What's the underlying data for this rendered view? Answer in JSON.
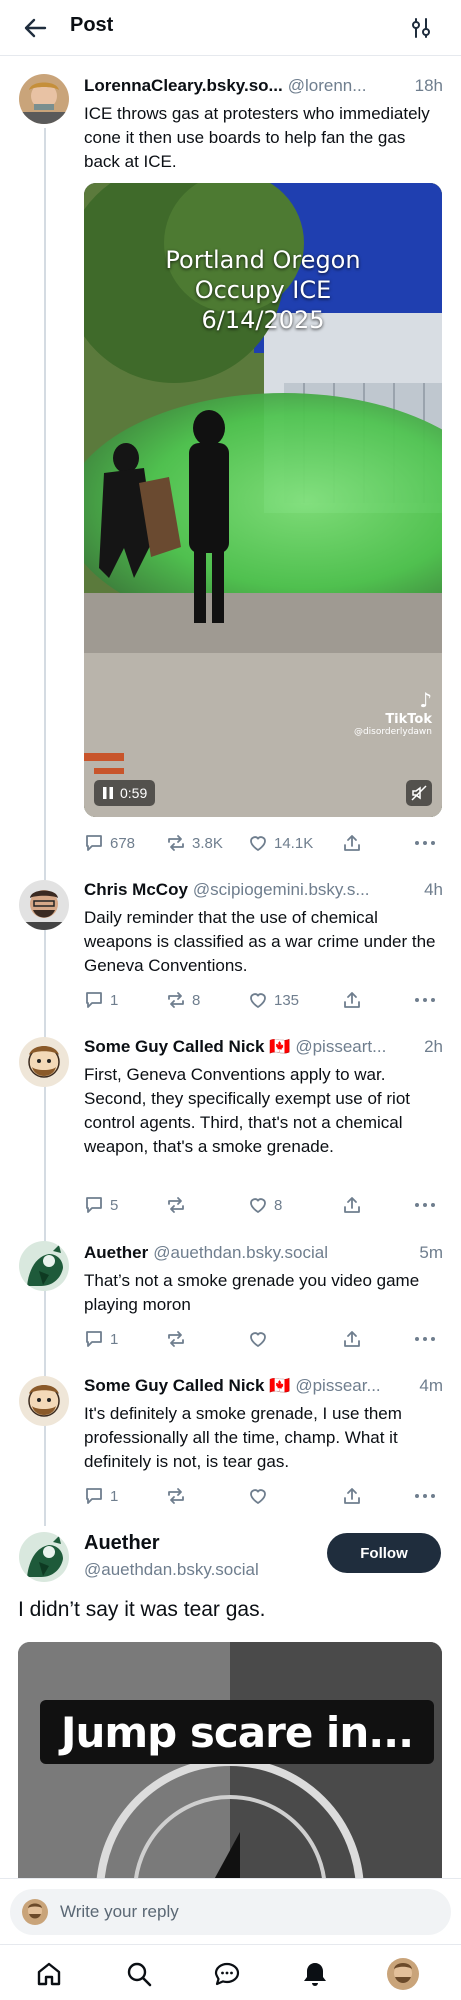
{
  "header": {
    "title": "Post",
    "back_icon": "arrow-left-icon",
    "settings_icon": "sliders-icon"
  },
  "posts": [
    {
      "name": "LorennaCleary.bsky.so...",
      "handle": "@lorenn...",
      "time": "18h",
      "text": "ICE throws gas at protesters who immediately cone it then use boards to help fan the gas back at ICE.",
      "video": {
        "caption_lines": [
          "Portland Oregon",
          "Occupy ICE",
          "6/14/2025"
        ],
        "watermark": "TikTok",
        "watermark_user": "@disorderlydawn",
        "duration": "0:59"
      },
      "replies": "678",
      "reposts": "3.8K",
      "likes": "14.1K"
    },
    {
      "name": "Chris McCoy",
      "handle": "@scipiogemini.bsky.s...",
      "time": "4h",
      "text": "Daily reminder that the use of chemical weapons is classified as a war crime under the Geneva Conventions.",
      "replies": "1",
      "reposts": "8",
      "likes": "135"
    },
    {
      "name": "Some Guy Called Nick 🇨🇦",
      "handle": "@pisseart...",
      "time": "2h",
      "text": "First, Geneva Conventions apply to war. Second, they specifically exempt use of riot control agents. Third, that's not a chemical weapon, that's a smoke grenade.",
      "replies": "5",
      "reposts": "",
      "likes": "8"
    },
    {
      "name": "Auether",
      "handle": "@auethdan.bsky.social",
      "time": "5m",
      "text": "That’s not a smoke grenade you video game playing moron",
      "replies": "1",
      "reposts": "",
      "likes": ""
    },
    {
      "name": "Some Guy Called Nick 🇨🇦",
      "handle": "@pissear...",
      "time": "4m",
      "text": "It's definitely a smoke grenade, I use them professionally all the time, champ. What it definitely is not, is tear gas.",
      "replies": "1",
      "reposts": "",
      "likes": ""
    }
  ],
  "focused": {
    "name": "Auether",
    "handle": "@auethdan.bsky.social",
    "follow_label": "Follow",
    "text": "I didn’t say it was tear gas.",
    "embed_text": "Jump scare in..."
  },
  "reply_bar": {
    "placeholder": "Write your reply"
  },
  "nav": [
    "home-icon",
    "search-icon",
    "chat-icon",
    "bell-icon",
    "profile-avatar"
  ]
}
